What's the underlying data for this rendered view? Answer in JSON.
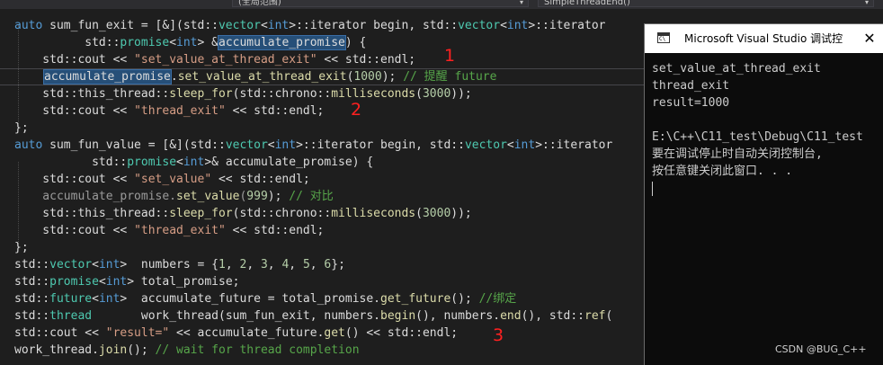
{
  "toolbar": {
    "scope_dropdown": "(全局范围)",
    "member_dropdown": "SimpleThreadEnd()"
  },
  "code": {
    "l1": {
      "a": "auto",
      "b": " sum_fun_exit = [&](std::",
      "c": "vector",
      "d": "<",
      "e": "int",
      "f": ">::iterator begin, std::",
      "g": "vector",
      "h": "<",
      "i": "int",
      "j": ">::iterator"
    },
    "l2": {
      "a": "          std::",
      "b": "promise",
      "c": "<",
      "d": "int",
      "e": "> &",
      "f": "accumulate_promise",
      "g": ") {"
    },
    "l3": {
      "a": "    std::cout << ",
      "b": "\"set_value_at_thread_exit\"",
      "c": " << std::endl;"
    },
    "l4": {
      "a": "accumulate_promise",
      "b": ".",
      "c": "set_value_at_thread_exit",
      "d": "(",
      "e": "1000",
      "f": "); ",
      "g": "// 提醒 future"
    },
    "l5": {
      "a": "    std::this_thread::",
      "b": "sleep_for",
      "c": "(std::chrono::",
      "d": "milliseconds",
      "e": "(",
      "f": "3000",
      "g": "));"
    },
    "l6": {
      "a": "    std::cout << ",
      "b": "\"thread_exit\"",
      "c": " << std::endl;"
    },
    "l7": {
      "a": "};"
    },
    "l8": {
      "a": "auto",
      "b": " sum_fun_value = [&](std::",
      "c": "vector",
      "d": "<",
      "e": "int",
      "f": ">::iterator begin, std::",
      "g": "vector",
      "h": "<",
      "i": "int",
      "j": ">::iterator"
    },
    "l9": {
      "a": "           std::",
      "b": "promise",
      "c": "<",
      "d": "int",
      "e": ">& accumulate_promise) {"
    },
    "l10": {
      "a": "    std::cout << ",
      "b": "\"set_value\"",
      "c": " << std::endl;"
    },
    "l11": {
      "a": "    accumulate_promise.",
      "b": "set_value",
      "c": "(",
      "d": "999",
      "e": "); ",
      "f": "// 对比"
    },
    "l12": {
      "a": "    std::this_thread::",
      "b": "sleep_for",
      "c": "(std::chrono::",
      "d": "milliseconds",
      "e": "(",
      "f": "3000",
      "g": "));"
    },
    "l13": {
      "a": "    std::cout << ",
      "b": "\"thread_exit\"",
      "c": " << std::endl;"
    },
    "l14": {
      "a": "};"
    },
    "l15": {
      "a": "std::",
      "b": "vector",
      "c": "<",
      "d": "int",
      "e": ">  numbers = {",
      "f": "1",
      "g": ", ",
      "h": "2",
      "i": ", ",
      "j": "3",
      "k": ", ",
      "l": "4",
      "m": ", ",
      "n": "5",
      "o": ", ",
      "p": "6",
      "q": "};"
    },
    "l16": {
      "a": "std::",
      "b": "promise",
      "c": "<",
      "d": "int",
      "e": "> total_promise;"
    },
    "l17": {
      "a": "std::",
      "b": "future",
      "c": "<",
      "d": "int",
      "e": ">  accumulate_future = total_promise.",
      "f": "get_future",
      "g": "(); ",
      "h": "//绑定"
    },
    "l18": {
      "a": "std::",
      "b": "thread",
      "c": "       work_thread(sum_fun_exit, numbers.",
      "d": "begin",
      "e": "(), numbers.",
      "f": "end",
      "g": "(), std::",
      "h": "ref",
      "i": "("
    },
    "l19": {
      "a": "std::cout << ",
      "b": "\"result=\"",
      "c": " << accumulate_future.",
      "d": "get",
      "e": "() << std::endl;"
    },
    "l20": {
      "a": "work_thread.",
      "b": "join",
      "c": "(); ",
      "d": "// wait for thread completion"
    }
  },
  "annotations": {
    "one": "1",
    "two": "2",
    "three": "3"
  },
  "console": {
    "title": "Microsoft Visual Studio 调试控",
    "close_glyph": "✕",
    "icon_text": "C\\",
    "lines": [
      "set_value_at_thread_exit",
      "thread_exit",
      "result=1000",
      "",
      "E:\\C++\\C11_test\\Debug\\C11_test",
      "要在调试停止时自动关闭控制台,",
      "按任意键关闭此窗口. . ."
    ]
  },
  "watermark": "CSDN @BUG_C++",
  "colors": {
    "keyword": "#569cd6",
    "type": "#4ec9b0",
    "function": "#dcdcaa",
    "string": "#d69d85",
    "number": "#b5cea8",
    "comment": "#57a64a",
    "annotation": "#ff2020"
  }
}
